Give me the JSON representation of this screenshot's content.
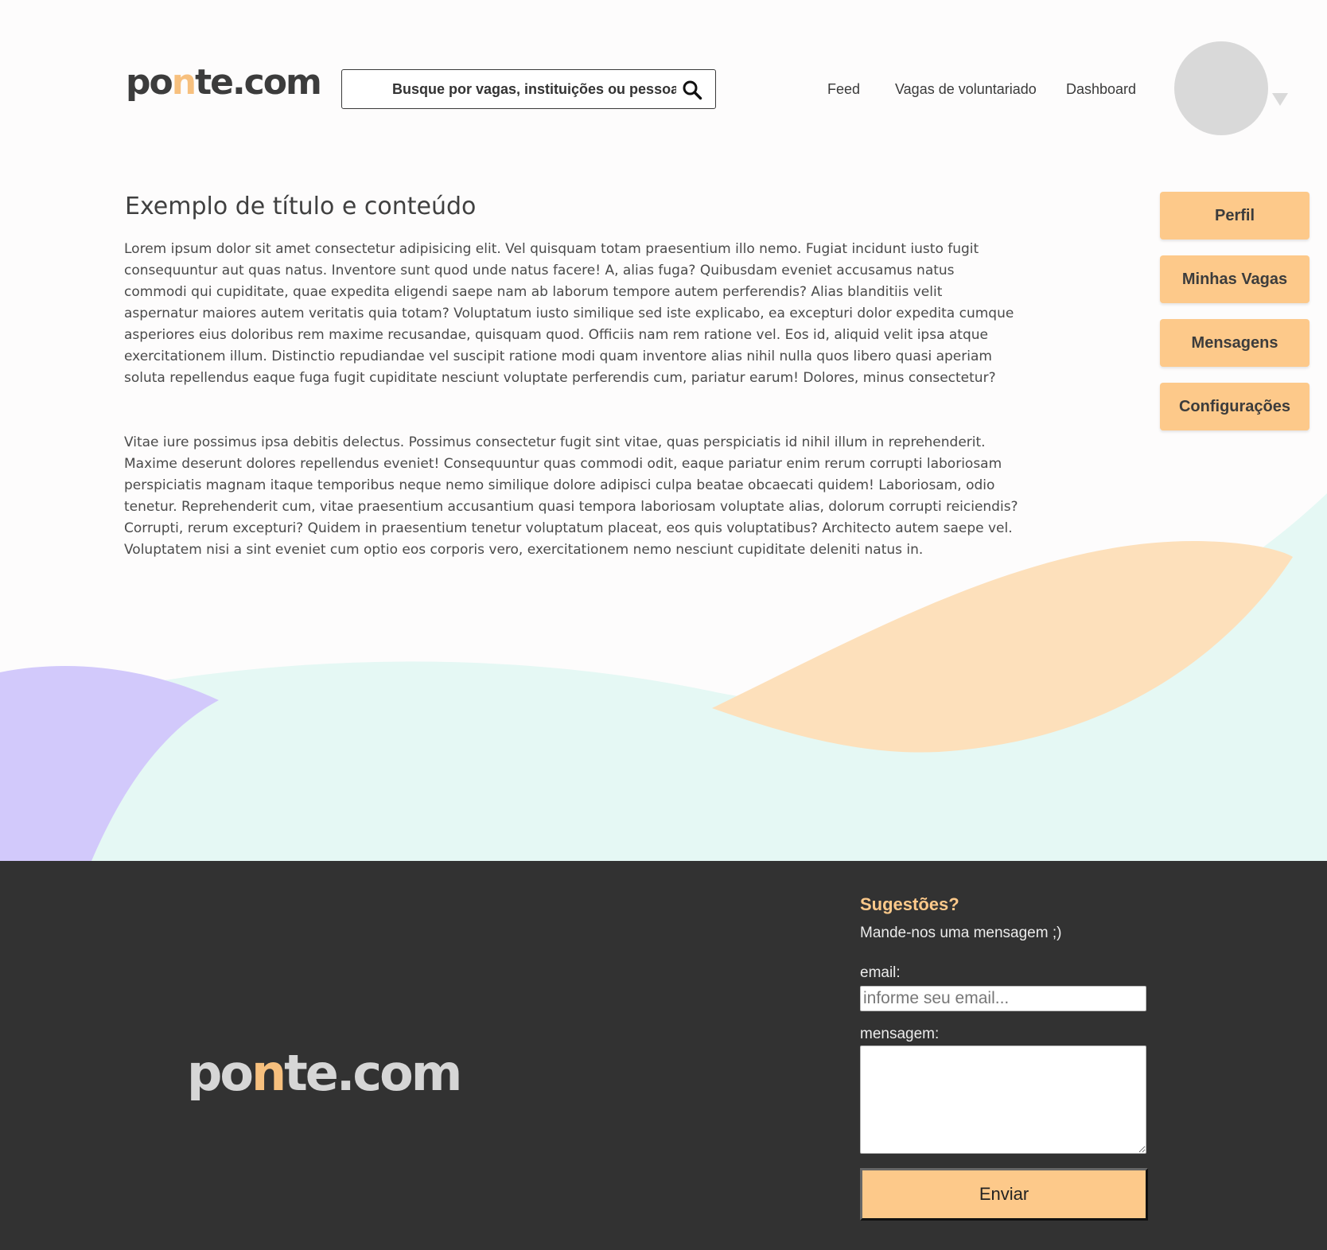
{
  "brand": {
    "logo_pre": "po",
    "logo_arch": "n",
    "logo_post": "te.com"
  },
  "header": {
    "search_placeholder": "Busque por vagas, instituições ou pessoas",
    "nav": [
      "Feed",
      "Vagas de voluntariado",
      "Dashboard"
    ]
  },
  "main": {
    "title": "Exemplo de título e conteúdo",
    "paragraphs": [
      "Lorem ipsum dolor sit amet consectetur adipisicing elit. Vel quisquam totam praesentium illo nemo. Fugiat incidunt iusto fugit consequuntur aut quas natus. Inventore sunt quod unde natus facere! A, alias fuga? Quibusdam eveniet accusamus natus commodi qui cupiditate, quae expedita eligendi saepe nam ab laborum tempore autem perferendis? Alias blanditiis velit aspernatur maiores autem veritatis quia totam? Voluptatum iusto similique sed iste explicabo, ea excepturi dolor expedita cumque asperiores eius doloribus rem maxime recusandae, quisquam quod. Officiis nam rem ratione vel. Eos id, aliquid velit ipsa atque exercitationem illum. Distinctio repudiandae vel suscipit ratione modi quam inventore alias nihil nulla quos libero quasi aperiam soluta repellendus eaque fuga fugit cupiditate nesciunt voluptate perferendis cum, pariatur earum! Dolores, minus consectetur?",
      "Vitae iure possimus ipsa debitis delectus. Possimus consectetur fugit sint vitae, quas perspiciatis id nihil illum in reprehenderit. Maxime deserunt dolores repellendus eveniet! Consequuntur quas commodi odit, eaque pariatur enim rerum corrupti laboriosam perspiciatis magnam itaque temporibus neque nemo similique dolore adipisci culpa beatae obcaecati quidem! Laboriosam, odio tenetur. Reprehenderit cum, vitae praesentium accusantium quasi tempora laboriosam voluptate alias, dolorum corrupti reiciendis? Corrupti, rerum excepturi? Quidem in praesentium tenetur voluptatum placeat, eos quis voluptatibus? Architecto autem saepe vel. Voluptatem nisi a sint eveniet cum optio eos corporis vero, exercitationem nemo nesciunt cupiditate deleniti natus in."
    ]
  },
  "sidebar": {
    "buttons": [
      "Perfil",
      "Minhas Vagas",
      "Mensagens",
      "Configurações"
    ]
  },
  "footer": {
    "suggestions_title": "Sugestões?",
    "suggestions_subtitle": "Mande-nos uma mensagem ;)",
    "email_label": "email:",
    "email_placeholder": "informe seu email...",
    "message_label": "mensagem:",
    "send_label": "Enviar"
  },
  "colors": {
    "accent": "#fdc98a",
    "footer_bg": "#323232",
    "wave_mint": "#e5f8f4",
    "wave_peach": "#fde0bb",
    "wave_lavender": "#d2c9fb"
  }
}
